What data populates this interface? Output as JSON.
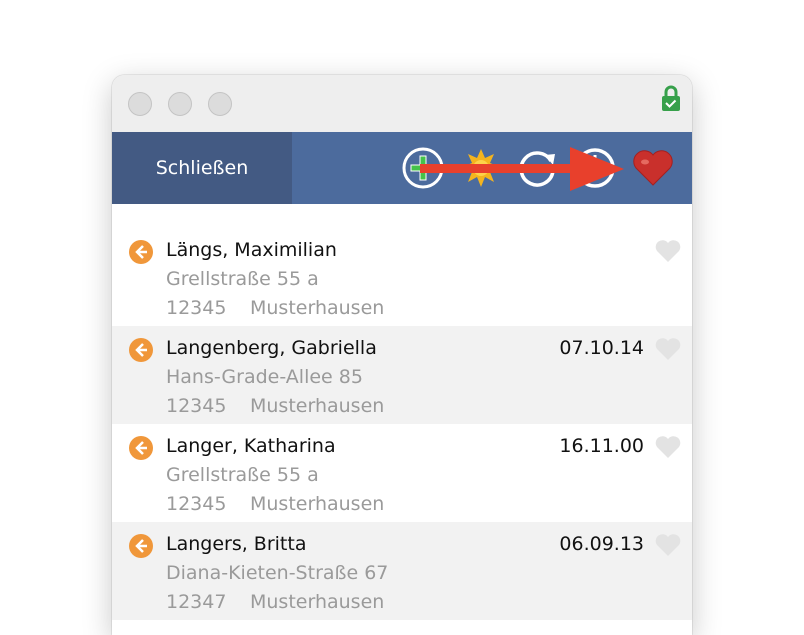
{
  "toolbar": {
    "close_label": "Schließen",
    "icons": [
      "add-icon",
      "sun-icon",
      "refresh-icon",
      "power-icon",
      "heart-icon"
    ]
  },
  "colors": {
    "toolbar_bg": "#4c6b9d",
    "close_bg": "#435a83",
    "arrow": "#e8402c",
    "row_icon": "#f0973a",
    "heart_active": "#c9302c",
    "heart_inactive": "#e3e3e3",
    "lock": "#37a04b"
  },
  "contacts": [
    {
      "name": "Längs, Maximilian",
      "street": "Grellstraße 55 a",
      "zip": "12345",
      "city": "Musterhausen",
      "date": ""
    },
    {
      "name": "Langenberg, Gabriella",
      "street": "Hans-Grade-Allee 85",
      "zip": "12345",
      "city": "Musterhausen",
      "date": "07.10.14"
    },
    {
      "name": "Langer, Katharina",
      "street": "Grellstraße 55 a",
      "zip": "12345",
      "city": "Musterhausen",
      "date": "16.11.00"
    },
    {
      "name": "Langers, Britta",
      "street": "Diana-Kieten-Straße 67",
      "zip": "12347",
      "city": "Musterhausen",
      "date": "06.09.13"
    }
  ]
}
